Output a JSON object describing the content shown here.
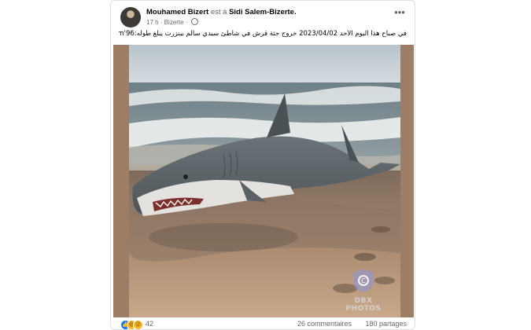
{
  "post": {
    "author": "Mouhamed Bizert",
    "location_prefix": "est à",
    "location": "Sidi Salem-Bizerte.",
    "time": "17 h",
    "place": "· Bizerte ·",
    "body_text": "في صباح هذا اليوم الأحد 2023/04/02 خروج جثة قرش في شاطئ سيدي سالم ببنزرت يبلغ طوله:96'6m",
    "watermark": "DBX PHOTOS"
  },
  "footer": {
    "reaction_count": "42",
    "comments": "26 commentaires",
    "shares": "180 partages"
  },
  "colors": {
    "facebook_blue": "#1877f2",
    "text": "#050505",
    "muted": "#65676b"
  },
  "icons": [
    "globe-icon",
    "more-options-icon",
    "like-reaction-icon",
    "haha-reaction-icon",
    "wow-reaction-icon",
    "watermark-logo-icon"
  ]
}
